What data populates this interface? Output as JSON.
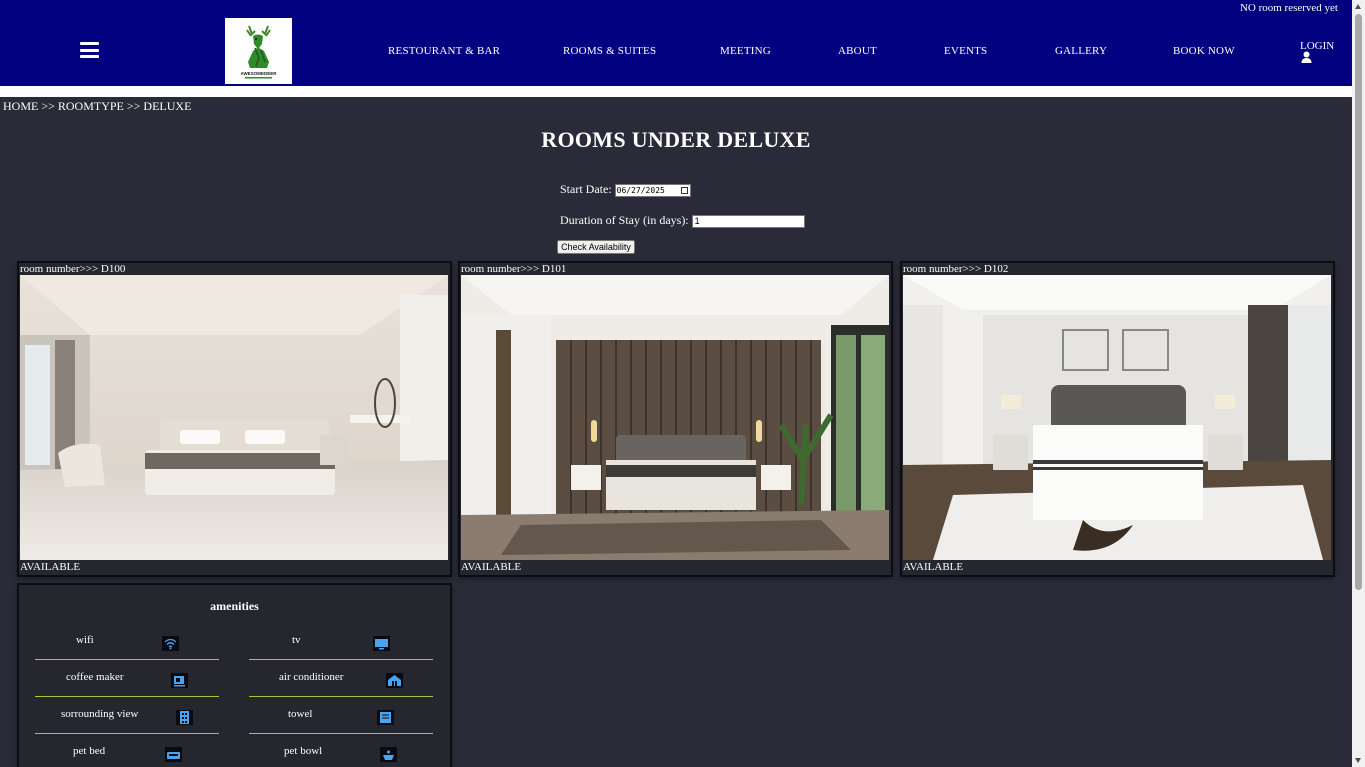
{
  "header": {
    "reserved_note": "NO room reserved yet",
    "nav": [
      "RESTOURANT & BAR",
      "ROOMS & SUITES",
      "MEETING",
      "ABOUT",
      "EVENTS",
      "GALLERY",
      "BOOK NOW"
    ],
    "login": "LOGIN",
    "logo_text": "AWESOMEDEER",
    "brand_color": "#020280"
  },
  "breadcrumb": "HOME >> ROOMTYPE >> DELUXE",
  "title": "ROOMS UNDER DELUXE",
  "form": {
    "start_date_label": "Start Date:",
    "start_date_value": "06/27/2025",
    "duration_label": "Duration of Stay (in days):",
    "duration_value": "1",
    "check_button": "Check Availability"
  },
  "rooms": [
    {
      "label": "room number>>> D100",
      "status": "AVAILABLE"
    },
    {
      "label": "room number>>> D101",
      "status": "AVAILABLE"
    },
    {
      "label": "room number>>> D102",
      "status": "AVAILABLE"
    }
  ],
  "amenities": {
    "title": "amenities",
    "items": [
      {
        "name": "wifi",
        "icon": "wifi-icon"
      },
      {
        "name": "tv",
        "icon": "tv-icon"
      },
      {
        "name": "coffee maker",
        "icon": "coffee-icon"
      },
      {
        "name": "air conditioner",
        "icon": "air-conditioner-icon"
      },
      {
        "name": "sorrounding view",
        "icon": "building-icon"
      },
      {
        "name": "towel",
        "icon": "towel-icon"
      },
      {
        "name": "pet bed",
        "icon": "pet-bed-icon"
      },
      {
        "name": "pet bowl",
        "icon": "pet-bowl-icon"
      }
    ],
    "divider_color": "#9acd32",
    "icon_color": "#4aa3f0"
  }
}
